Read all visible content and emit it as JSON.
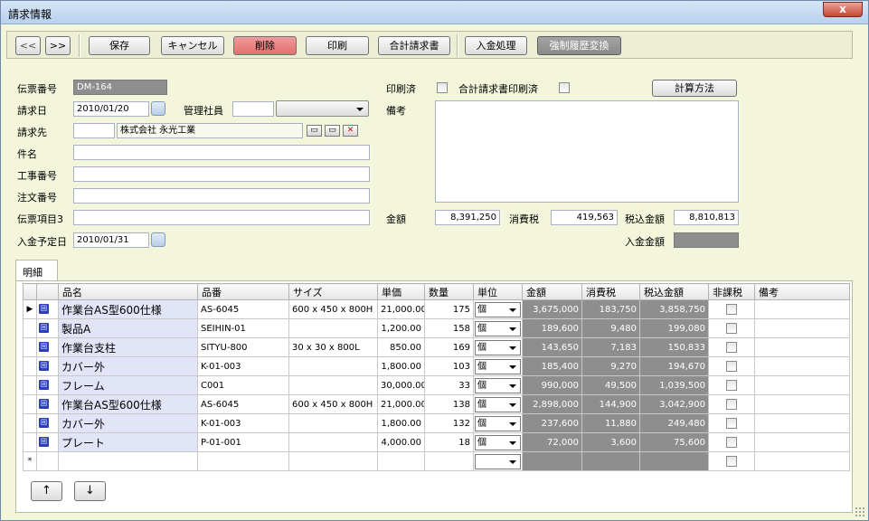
{
  "window": {
    "title": "請求情報",
    "close_glyph": "x"
  },
  "toolbar": {
    "prev_label": "<<",
    "next_label": ">>",
    "save_label": "保存",
    "cancel_label": "キャンセル",
    "delete_label": "削除",
    "print_label": "印刷",
    "summary_invoice_label": "合計請求書",
    "payment_label": "入金処理",
    "force_history_label": "強制履歴変換"
  },
  "form": {
    "slip_no_label": "伝票番号",
    "slip_no": "DM-164",
    "invoice_date_label": "請求日",
    "invoice_date": "2010/01/20",
    "manager_label": "管理社員",
    "manager_code": "",
    "manager_name": "",
    "billing_label": "請求先",
    "billing_code": "",
    "billing_name": "株式会社 永光工業",
    "subject_label": "件名",
    "subject": "",
    "work_no_label": "工事番号",
    "work_no": "",
    "order_no_label": "注文番号",
    "order_no": "",
    "slip_item3_label": "伝票項目3",
    "slip_item3": "",
    "payment_due_label": "入金予定日",
    "payment_due": "2010/01/31",
    "printed_label": "印刷済",
    "summary_printed_label": "合計請求書印刷済",
    "calc_method_label": "計算方法",
    "remarks_label": "備考",
    "remarks": "",
    "amount_label": "金額",
    "amount": "8,391,250",
    "tax_label": "消費税",
    "tax": "419,563",
    "total_label": "税込金額",
    "total": "8,810,813",
    "paid_label": "入金金額",
    "paid": ""
  },
  "tab": {
    "label": "明細"
  },
  "grid": {
    "columns": [
      "品名",
      "品番",
      "サイズ",
      "単価",
      "数量",
      "単位",
      "金額",
      "消費税",
      "税込金額",
      "非課税",
      "備考"
    ],
    "current_row_marker": "▶",
    "new_row_marker": "*",
    "row_icon": "回",
    "rows": [
      {
        "name": "作業台AS型600仕様",
        "code": "AS-6045",
        "size": "600 x 450 x 800H",
        "price": "21,000.00",
        "qty": "175",
        "unit": "個",
        "amount": "3,675,000",
        "tax": "183,750",
        "total": "3,858,750",
        "exempt": false,
        "note": ""
      },
      {
        "name": "製品A",
        "code": "SEIHIN-01",
        "size": "",
        "price": "1,200.00",
        "qty": "158",
        "unit": "個",
        "amount": "189,600",
        "tax": "9,480",
        "total": "199,080",
        "exempt": false,
        "note": ""
      },
      {
        "name": "作業台支柱",
        "code": "SITYU-800",
        "size": "30 x 30 x 800L",
        "price": "850.00",
        "qty": "169",
        "unit": "個",
        "amount": "143,650",
        "tax": "7,183",
        "total": "150,833",
        "exempt": false,
        "note": ""
      },
      {
        "name": "カバー外",
        "code": "K-01-003",
        "size": "",
        "price": "1,800.00",
        "qty": "103",
        "unit": "個",
        "amount": "185,400",
        "tax": "9,270",
        "total": "194,670",
        "exempt": false,
        "note": ""
      },
      {
        "name": "フレーム",
        "code": "C001",
        "size": "",
        "price": "30,000.00",
        "qty": "33",
        "unit": "個",
        "amount": "990,000",
        "tax": "49,500",
        "total": "1,039,500",
        "exempt": false,
        "note": ""
      },
      {
        "name": "作業台AS型600仕様",
        "code": "AS-6045",
        "size": "600 x 450 x 800H",
        "price": "21,000.00",
        "qty": "138",
        "unit": "個",
        "amount": "2,898,000",
        "tax": "144,900",
        "total": "3,042,900",
        "exempt": false,
        "note": ""
      },
      {
        "name": "カバー外",
        "code": "K-01-003",
        "size": "",
        "price": "1,800.00",
        "qty": "132",
        "unit": "個",
        "amount": "237,600",
        "tax": "11,880",
        "total": "249,480",
        "exempt": false,
        "note": ""
      },
      {
        "name": "プレート",
        "code": "P-01-001",
        "size": "",
        "price": "4,000.00",
        "qty": "18",
        "unit": "個",
        "amount": "72,000",
        "tax": "3,600",
        "total": "75,600",
        "exempt": false,
        "note": ""
      }
    ]
  },
  "row_move": {
    "up_label": "↑",
    "down_label": "↓"
  }
}
